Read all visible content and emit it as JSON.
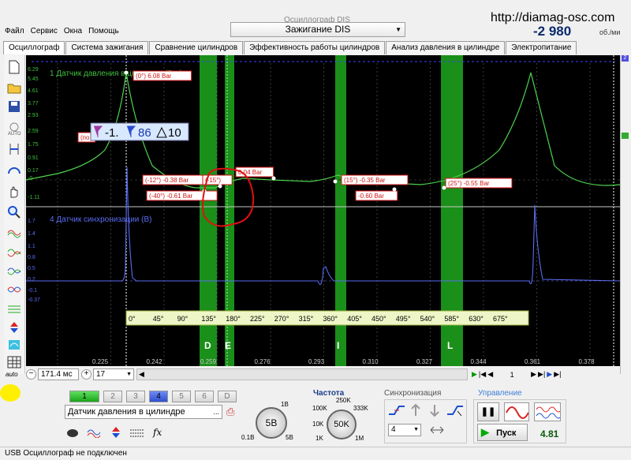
{
  "window": {
    "ghost_title": "Осциллограф DIS",
    "site": "http://diamag-osc.com"
  },
  "menu": [
    "Файл",
    "Сервис",
    "Окна",
    "Помощь"
  ],
  "mode_select": {
    "value": "Зажигание DIS"
  },
  "rpm": {
    "value": "-2   980",
    "unit": "об./ми"
  },
  "tabs": [
    "Осциллограф",
    "Система зажигания",
    "Сравнение цилиндров",
    "Эффективность работы цилиндров",
    "Анализ давления в цилиндре",
    "Электропитание"
  ],
  "tools": [
    "new-file",
    "open-folder",
    "save-disk",
    "auto",
    "cursor-split",
    "measure-arc",
    "hand",
    "zoom",
    "waveforms"
  ],
  "scope": {
    "channel1_label": "1 Датчик давления в цилиндре (Bar)",
    "channel4_label": "4 Датчик синхронизации (В)",
    "y_ticks_ch1": [
      "6.29",
      "5.45",
      "4.61",
      "3.77",
      "2.93",
      "2.59",
      "1.75",
      "0.91",
      "0.17",
      "-0",
      "-1.11"
    ],
    "y_ticks_ch4": [
      "1.7",
      "1.4",
      "1.1",
      "0.8",
      "0.5",
      "0.2",
      "-0.1",
      "-0.37"
    ],
    "x_ticks": [
      "0.225",
      "0.242",
      "0.259",
      "0.276",
      "0.293",
      "0.310",
      "0.327",
      "0.344",
      "0.361",
      "0.378"
    ],
    "degree_ticks": [
      "0°",
      "45°",
      "90°",
      "135°",
      "180°",
      "225°",
      "270°",
      "315°",
      "360°",
      "405°",
      "450°",
      "495°",
      "540°",
      "585°",
      "630°",
      "675°"
    ],
    "phase_labels": [
      "D",
      "E",
      "I",
      "L"
    ],
    "annotations": [
      "(0°) 6.08 Bar",
      "(-12°) -0.38 Bar",
      "(-15°)",
      "(-40°) -0.61 Bar",
      "0.04 Bar",
      "(15°) -0.35 Bar",
      "-0.60 Bar",
      "(25°) -0.55 Bar",
      "(по"
    ],
    "cursor_box": {
      "left_value": "-1.",
      "right_value": "86",
      "delta_value": "10"
    },
    "colors": {
      "ch1": "#4ed44e",
      "ch4": "#5a6cf0",
      "band": "#1a8f1a",
      "annotation": "#d11414",
      "circle": "#e01010"
    }
  },
  "timebase": {
    "value": "171.4 мс",
    "channel": "17",
    "page": "1"
  },
  "channels": [
    "1",
    "2",
    "3",
    "4",
    "5",
    "6",
    "D"
  ],
  "sensor": {
    "value": "Датчик давления в цилиндре"
  },
  "amplitude": {
    "value": "5B",
    "min": "0.1B",
    "max": "5B",
    "top": "1B"
  },
  "frequency": {
    "label": "Частота",
    "value": "50K",
    "marks": [
      "250K",
      "100K",
      "333K",
      "10K",
      "1K",
      "1M"
    ]
  },
  "sync": {
    "label": "Синхронизация",
    "value": "4"
  },
  "control": {
    "label": "Управление",
    "start": "Пуск",
    "reading": "4.81"
  },
  "status": "USB Осциллограф не подключен"
}
